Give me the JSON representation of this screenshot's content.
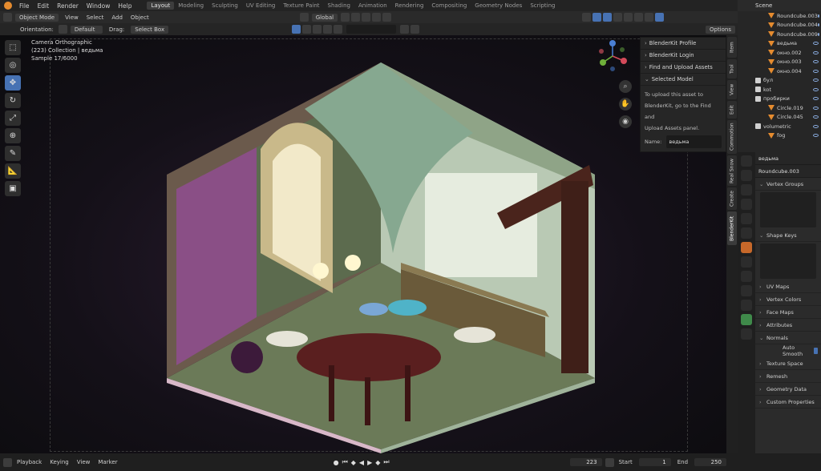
{
  "menu": [
    "File",
    "Edit",
    "Render",
    "Window",
    "Help"
  ],
  "workspaces": [
    "Layout",
    "Modeling",
    "Sculpting",
    "UV Editing",
    "Texture Paint",
    "Shading",
    "Animation",
    "Rendering",
    "Compositing",
    "Geometry Nodes",
    "Scripting"
  ],
  "active_workspace": "Layout",
  "scene_name": "Scene",
  "header": {
    "mode": "Object Mode",
    "view": "View",
    "select": "Select",
    "add": "Add",
    "object": "Object",
    "orientation_label": "Orientation:",
    "orientation_value": "Default",
    "drag_label": "Drag:",
    "drag_value": "Select Box",
    "transform": "Global",
    "options": "Options"
  },
  "viewport_info": {
    "line1": "Camera Orthographic",
    "line2": "(223) Collection | ведьма",
    "line3": "Sample 17/6000"
  },
  "blenderkit": {
    "profile": "BlenderKit Profile",
    "login": "BlenderKit Login",
    "find": "Find and Upload Assets",
    "selected": "Selected Model",
    "line1": "To upload this asset to",
    "line2": "BlenderKit, go to the Find and",
    "line3": "Upload Assets panel.",
    "name_label": "Name:",
    "name_value": "ведьма"
  },
  "side_tabs": [
    "Item",
    "Tool",
    "View",
    "Edit",
    "Commotion",
    "Real Snow",
    "Create",
    "BlenderKit"
  ],
  "outliner": [
    {
      "name": "Roundcube.003",
      "kind": "mesh"
    },
    {
      "name": "Roundcube.004",
      "kind": "mesh"
    },
    {
      "name": "Roundcube.009",
      "kind": "mesh"
    },
    {
      "name": "ведьма",
      "kind": "mesh"
    },
    {
      "name": "окно.002",
      "kind": "mesh"
    },
    {
      "name": "окно.003",
      "kind": "mesh"
    },
    {
      "name": "окно.004",
      "kind": "mesh"
    },
    {
      "name": "бул",
      "kind": "collection"
    },
    {
      "name": "kot",
      "kind": "collection"
    },
    {
      "name": "пробирки",
      "kind": "collection"
    },
    {
      "name": "Circle.019",
      "kind": "mesh"
    },
    {
      "name": "Circle.045",
      "kind": "mesh"
    },
    {
      "name": "volumetric",
      "kind": "collection"
    },
    {
      "name": "fog",
      "kind": "mesh"
    }
  ],
  "properties": {
    "object_name": "ведьма",
    "mesh_name": "Roundcube.003",
    "sections": [
      "Vertex Groups",
      "Shape Keys",
      "UV Maps",
      "Vertex Colors",
      "Face Maps",
      "Attributes",
      "Normals",
      "Texture Space",
      "Remesh",
      "Geometry Data",
      "Custom Properties"
    ],
    "auto_smooth": "Auto Smooth"
  },
  "timeline": {
    "playback": "Playback",
    "keying": "Keying",
    "view": "View",
    "marker": "Marker",
    "current_frame": "223",
    "start_label": "Start",
    "start_value": "1",
    "end_label": "End",
    "end_value": "250"
  },
  "colors": {
    "accent": "#4772b3",
    "mesh_icon": "#e58b2f"
  }
}
